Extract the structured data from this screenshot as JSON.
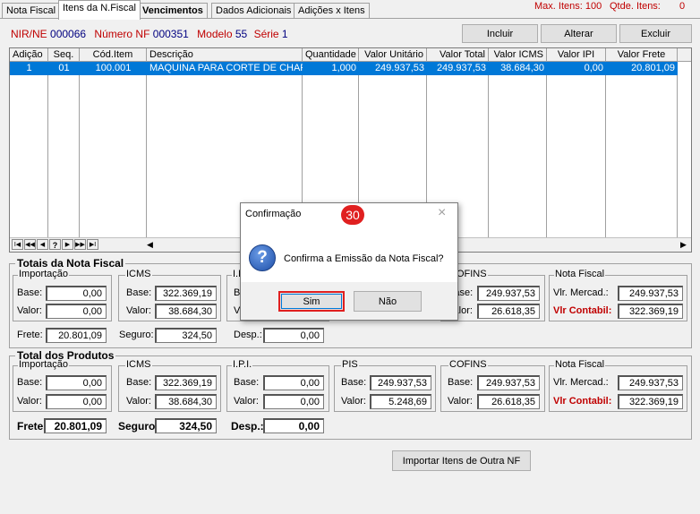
{
  "tabs": [
    "Nota Fiscal",
    "Itens da N.Fiscal",
    "Vencimentos",
    "Dados Adicionais",
    "Adições x Itens"
  ],
  "top_info": {
    "max_itens_label": "Max. Itens:",
    "max_itens": "100",
    "qtde_itens_label": "Qtde. Itens:",
    "qtde_itens": "0"
  },
  "header": {
    "nir_label": "NIR/NE",
    "nir": "000066",
    "nf_label": "Número NF",
    "nf": "000351",
    "modelo_label": "Modelo",
    "modelo": "55",
    "serie_label": "Série",
    "serie": "1"
  },
  "buttons": {
    "incluir": "Incluir",
    "alterar": "Alterar",
    "excluir": "Excluir",
    "importar": "Importar Itens de Outra NF"
  },
  "grid": {
    "columns": [
      "Adição",
      "Seq.",
      "Cód.Item",
      "Descrição",
      "Quantidade",
      "Valor Unitário",
      "Valor Total",
      "Valor ICMS",
      "Valor IPI",
      "Valor Frete"
    ],
    "rows": [
      [
        "1",
        "01",
        "100.001",
        "MAQUINA PARA CORTE DE CHAPA",
        "1,000",
        "249.937,53",
        "249.937,53",
        "38.684,30",
        "0,00",
        "20.801,09"
      ]
    ]
  },
  "nav_buttons": [
    "I◀",
    "◀◀",
    "◀",
    "?",
    "▶",
    "▶▶",
    "▶I"
  ],
  "totais_nf": {
    "title": "Totais da Nota Fiscal",
    "importacao": {
      "title": "Importação",
      "base_label": "Base:",
      "base": "0,00",
      "valor_label": "Valor:",
      "valor": "0,00"
    },
    "icms": {
      "title": "ICMS",
      "base_label": "Base:",
      "base": "322.369,19",
      "valor_label": "Valor:",
      "valor": "38.684,30"
    },
    "ipi_title": "I.P.I.",
    "ipi_base_label": "Bas",
    "ipi_valor_label": "Val",
    "cofins": {
      "title": "COFINS",
      "base_label": "Base:",
      "base": "249.937,53",
      "valor_label": "Valor:",
      "valor": "26.618,35"
    },
    "nota_fiscal": {
      "title": "Nota Fiscal",
      "vlr_mercad_label": "Vlr. Mercad.:",
      "vlr_mercad": "249.937,53",
      "vlr_contabil_label": "Vlr Contabil:",
      "vlr_contabil": "322.369,19"
    },
    "frete_label": "Frete:",
    "frete": "20.801,09",
    "seguro_label": "Seguro:",
    "seguro": "324,50",
    "desp_label": "Desp.:",
    "desp": "0,00"
  },
  "totais_produtos": {
    "title": "Total dos Produtos",
    "importacao": {
      "title": "Importação",
      "base_label": "Base:",
      "base": "0,00",
      "valor_label": "Valor:",
      "valor": "0,00"
    },
    "icms": {
      "title": "ICMS",
      "base_label": "Base:",
      "base": "322.369,19",
      "valor_label": "Valor:",
      "valor": "38.684,30"
    },
    "ipi": {
      "title": "I.P.I.",
      "base_label": "Base:",
      "base": "0,00",
      "valor_label": "Valor:",
      "valor": "0,00"
    },
    "pis": {
      "title": "PIS",
      "base_label": "Base:",
      "base": "249.937,53",
      "valor_label": "Valor:",
      "valor": "5.248,69"
    },
    "cofins": {
      "title": "COFINS",
      "base_label": "Base:",
      "base": "249.937,53",
      "valor_label": "Valor:",
      "valor": "26.618,35"
    },
    "nota_fiscal": {
      "title": "Nota Fiscal",
      "vlr_mercad_label": "Vlr. Mercad.:",
      "vlr_mercad": "249.937,53",
      "vlr_contabil_label": "Vlr Contabil:",
      "vlr_contabil": "322.369,19"
    },
    "frete_label": "Frete",
    "frete": "20.801,09",
    "seguro_label": "Seguro",
    "seguro": "324,50",
    "desp_label": "Desp.:",
    "desp": "0,00"
  },
  "dialog": {
    "title": "Confirmação",
    "badge": "30",
    "message": "Confirma a Emissão da Nota Fiscal?",
    "yes": "Sim",
    "no": "Não",
    "close": "×",
    "question_glyph": "?"
  },
  "colors": {
    "selection": "#0078d7",
    "accent_red": "#c00000",
    "navy": "#000080",
    "badge": "#e02020"
  }
}
